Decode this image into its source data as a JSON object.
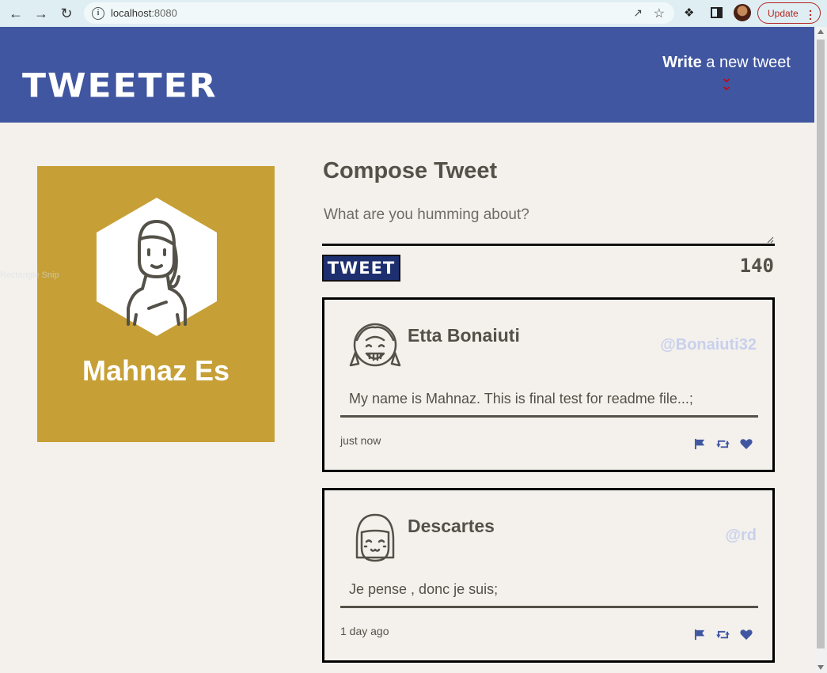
{
  "browser": {
    "url_host": "localhost",
    "url_port": ":8080",
    "update_label": "Update"
  },
  "header": {
    "logo": "TWEETER",
    "write_bold": "Write",
    "write_rest": " a new tweet"
  },
  "profile": {
    "name": "Mahnaz Es",
    "ghost_text": "Rectangle Snip"
  },
  "compose": {
    "title": "Compose Tweet",
    "placeholder": "What are you humming about?",
    "button_label": "TWEET",
    "counter": "140"
  },
  "tweets": [
    {
      "name": "Etta Bonaiuti",
      "handle": "@Bonaiuti32",
      "text": "My name is Mahnaz. This is final test for readme file...;",
      "time": "just now"
    },
    {
      "name": "Descartes",
      "handle": "@rd",
      "text": "Je pense , donc je suis;",
      "time": "1 day ago"
    }
  ],
  "colors": {
    "header_bg": "#4056a1",
    "profile_bg": "#c6a036",
    "page_bg": "#f4f1ec",
    "accent_red": "#cc0000",
    "action_icons": "#4056a1"
  }
}
